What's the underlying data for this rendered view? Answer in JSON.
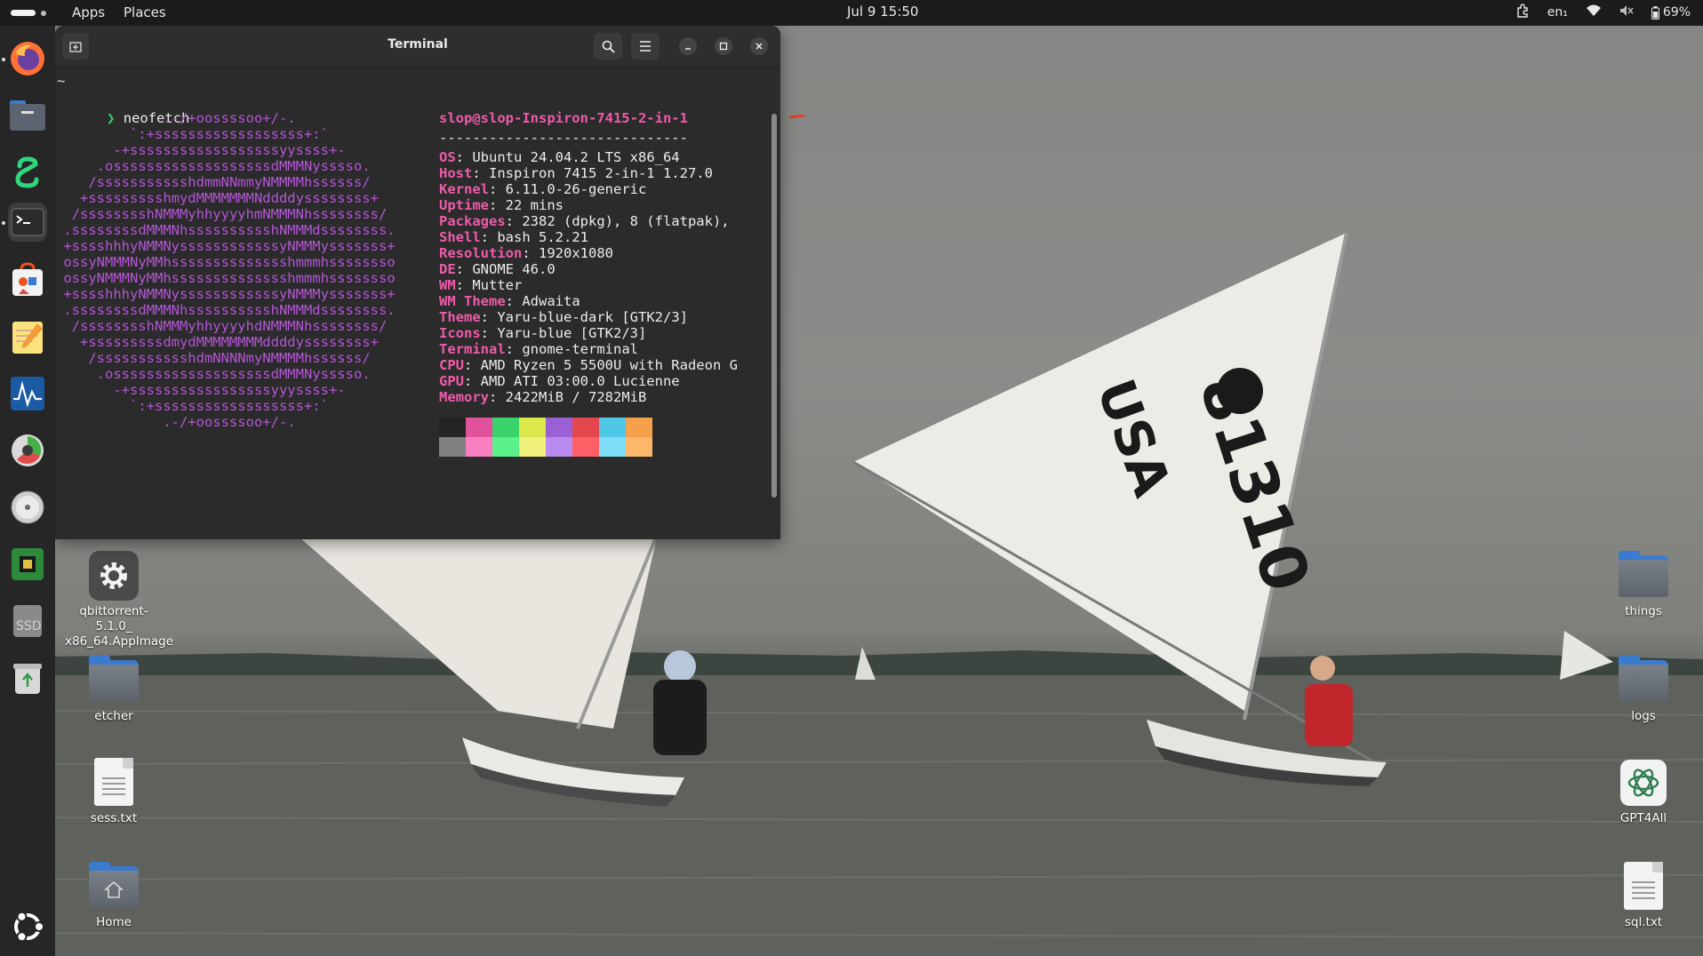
{
  "topbar": {
    "apps_label": "Apps",
    "places_label": "Places",
    "datetime": "Jul 9  15:50",
    "keyboard_layout": "en₁",
    "battery": "69%"
  },
  "dock": {
    "items": [
      "firefox-icon",
      "files-icon",
      "slack-icon",
      "terminal-icon",
      "app-center-icon",
      "text-editor-icon",
      "system-monitor-icon",
      "disk-usage-icon",
      "disks-icon",
      "cpu-icon",
      "ssd-icon",
      "trash-icon"
    ],
    "show_apps_icon": "ubuntu-icon"
  },
  "terminal": {
    "title": "Terminal",
    "prompt_tilde": "~",
    "prompt_symbol": "❯",
    "command": "neofetch",
    "user_host": "slop@slop-Inspiron-7415-2-in-1",
    "separator": "------------------------------",
    "info": [
      {
        "key": "OS",
        "value": " Ubuntu 24.04.2 LTS x86_64"
      },
      {
        "key": "Host",
        "value": " Inspiron 7415 2-in-1 1.27.0"
      },
      {
        "key": "Kernel",
        "value": " 6.11.0-26-generic"
      },
      {
        "key": "Uptime",
        "value": " 22 mins"
      },
      {
        "key": "Packages",
        "value": " 2382 (dpkg), 8 (flatpak),"
      },
      {
        "key": "Shell",
        "value": " bash 5.2.21"
      },
      {
        "key": "Resolution",
        "value": " 1920x1080"
      },
      {
        "key": "DE",
        "value": " GNOME 46.0"
      },
      {
        "key": "WM",
        "value": " Mutter"
      },
      {
        "key": "WM Theme",
        "value": " Adwaita"
      },
      {
        "key": "Theme",
        "value": " Yaru-blue-dark [GTK2/3]"
      },
      {
        "key": "Icons",
        "value": " Yaru-blue [GTK2/3]"
      },
      {
        "key": "Terminal",
        "value": " gnome-terminal"
      },
      {
        "key": "CPU",
        "value": " AMD Ryzen 5 5500U with Radeon G"
      },
      {
        "key": "GPU",
        "value": " AMD ATI 03:00.0 Lucienne"
      },
      {
        "key": "Memory",
        "value": " 2422MiB / 7282MiB"
      }
    ],
    "logo": [
      "             .-/+oossssoo+/-.",
      "         `:+ssssssssssssssssss+:`",
      "       -+ssssssssssssssssssyyssss+-",
      "     .osssssssssssssssssssdMMMNysssso.",
      "    /ssssssssssshdmmNNmmyNMMMMhssssss/",
      "   +ssssssssshmydMMMMMMMNddddyssssssss+",
      "  /sssssssshNMMMyhhyyyyhmNMMMNhssssssss/",
      " .ssssssssdMMMNhsssssssssshNMMMdssssssss.",
      " +sssshhhyNMMNyssssssssssssyNMMMysssssss+",
      " ossyNMMMNyMMhsssssssssssssshmmmhssssssso",
      " ossyNMMMNyMMhsssssssssssssshmmmhssssssso",
      " +sssshhhyNMMNyssssssssssssyNMMMysssssss+",
      " .ssssssssdMMMNhsssssssssshNMMMdssssssss.",
      "  /sssssssshNMMMyhhyyyyhdNMMMNhssssssss/",
      "   +sssssssssdmydMMMMMMMMddddyssssssss+",
      "    /ssssssssssshdmNNNNmyNMMMMhssssss/",
      "     .osssssssssssssssssssdMMMNysssso.",
      "       -+sssssssssssssssssyyyssss+-",
      "         `:+ssssssssssssssssss+:`",
      "             .-/+oossssoo+/-."
    ],
    "palette_top": [
      "#242424",
      "#e0529c",
      "#3ad36b",
      "#dce84a",
      "#9b5fd6",
      "#e5474e",
      "#4fc8e8",
      "#f5a04a"
    ],
    "palette_bottom": [
      "#808080",
      "#f77fc2",
      "#5af08a",
      "#eef07a",
      "#b98af0",
      "#ff5f66",
      "#7fdcf7",
      "#fdb66a"
    ]
  },
  "desktop": {
    "left": [
      {
        "label": "qbittorrent-5.1.0_\nx86_64.AppImage",
        "icon": "gear-icon"
      },
      {
        "label": "etcher",
        "icon": "folder-icon"
      },
      {
        "label": "sess.txt",
        "icon": "text-file-icon"
      },
      {
        "label": "Home",
        "icon": "home-folder-icon"
      }
    ],
    "right": [
      {
        "label": "things",
        "icon": "folder-icon"
      },
      {
        "label": "logs",
        "icon": "folder-icon"
      },
      {
        "label": "GPT4All",
        "icon": "gpt4all-icon"
      },
      {
        "label": "sql.txt",
        "icon": "text-file-icon"
      }
    ]
  },
  "wallpaper": {
    "sail_number": "81310",
    "sail_country": "USA"
  },
  "colors": {
    "topbar": "#1b1b1b",
    "dock": "#262626",
    "terminal_bg": "#2b2b2b",
    "accent_pink": "#ee5aaa",
    "logo_purple": "#b455d6"
  }
}
